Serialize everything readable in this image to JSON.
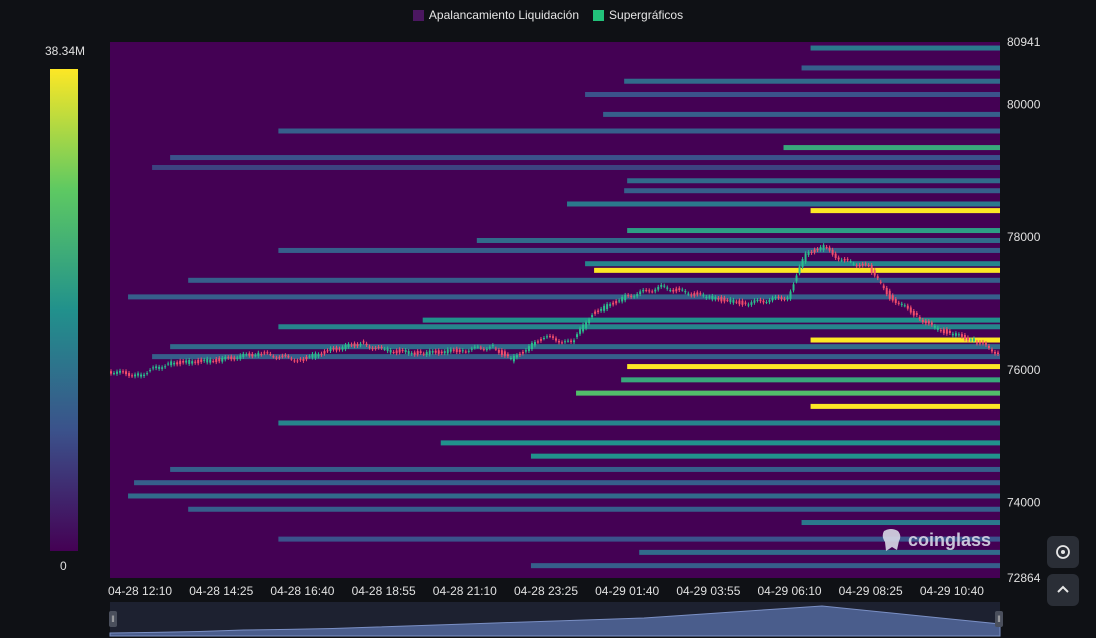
{
  "legend": {
    "items": [
      {
        "label": "Apalancamiento Liquidación",
        "color": "#4b1760"
      },
      {
        "label": "Supergráficos",
        "color": "#22c27a"
      }
    ]
  },
  "colorbar": {
    "max_label": "38.34M",
    "min_label": "0"
  },
  "watermark": {
    "text": "coinglass"
  },
  "controls": {
    "settings_icon": "settings-gear-icon",
    "up_icon": "chevron-up-icon"
  },
  "chart_data": {
    "type": "heatmap",
    "subtype": "liquidation-heatmap-with-candlesticks",
    "y_axis": {
      "position": "right",
      "range": [
        72864,
        80941
      ],
      "tick_labels": [
        "80941",
        "80000",
        "78000",
        "76000",
        "74000",
        "72864"
      ]
    },
    "x_axis": {
      "range": [
        "04-28 11:20",
        "04-29 12:00"
      ],
      "tick_labels": [
        "04-28 12:10",
        "04-28 14:25",
        "04-28 16:40",
        "04-28 18:55",
        "04-28 21:10",
        "04-28 23:25",
        "04-29 01:40",
        "04-29 03:55",
        "04-29 06:10",
        "04-29 08:25",
        "04-29 10:40"
      ]
    },
    "colorscale": {
      "min": 0,
      "max": 38340000,
      "colors": [
        "#440154",
        "#3b528b",
        "#21918c",
        "#5ec962",
        "#fde725"
      ]
    },
    "heat_bands": [
      {
        "price": 80850,
        "start": "04-29 06:45",
        "intensity": 0.4
      },
      {
        "price": 80550,
        "start": "04-29 06:30",
        "intensity": 0.3
      },
      {
        "price": 80350,
        "start": "04-29 01:35",
        "intensity": 0.35
      },
      {
        "price": 80150,
        "start": "04-29 00:30",
        "intensity": 0.25
      },
      {
        "price": 79850,
        "start": "04-29 01:00",
        "intensity": 0.3
      },
      {
        "price": 79600,
        "start": "04-28 16:00",
        "intensity": 0.3
      },
      {
        "price": 79350,
        "start": "04-29 06:00",
        "intensity": 0.6
      },
      {
        "price": 79200,
        "start": "04-28 13:00",
        "intensity": 0.25
      },
      {
        "price": 79050,
        "start": "04-28 12:30",
        "intensity": 0.2
      },
      {
        "price": 78850,
        "start": "04-29 01:40",
        "intensity": 0.35
      },
      {
        "price": 78700,
        "start": "04-29 01:35",
        "intensity": 0.3
      },
      {
        "price": 78500,
        "start": "04-29 00:00",
        "intensity": 0.4
      },
      {
        "price": 78400,
        "start": "04-29 06:45",
        "intensity": 1.0
      },
      {
        "price": 78100,
        "start": "04-29 01:40",
        "intensity": 0.55
      },
      {
        "price": 77950,
        "start": "04-28 21:30",
        "intensity": 0.35
      },
      {
        "price": 77800,
        "start": "04-28 16:00",
        "intensity": 0.3
      },
      {
        "price": 77600,
        "start": "04-29 00:30",
        "intensity": 0.45
      },
      {
        "price": 77500,
        "start": "04-29 00:45",
        "intensity": 1.0
      },
      {
        "price": 77350,
        "start": "04-28 13:30",
        "intensity": 0.3
      },
      {
        "price": 77100,
        "start": "04-28 11:50",
        "intensity": 0.3
      },
      {
        "price": 76750,
        "start": "04-28 20:00",
        "intensity": 0.5
      },
      {
        "price": 76650,
        "start": "04-28 16:00",
        "intensity": 0.45
      },
      {
        "price": 76450,
        "start": "04-29 06:45",
        "intensity": 1.0
      },
      {
        "price": 76350,
        "start": "04-28 13:00",
        "intensity": 0.35
      },
      {
        "price": 76200,
        "start": "04-28 12:30",
        "intensity": 0.3
      },
      {
        "price": 76050,
        "start": "04-29 01:40",
        "intensity": 1.0
      },
      {
        "price": 75850,
        "start": "04-29 01:30",
        "intensity": 0.6
      },
      {
        "price": 75650,
        "start": "04-29 00:15",
        "intensity": 0.7
      },
      {
        "price": 75450,
        "start": "04-29 06:45",
        "intensity": 1.0
      },
      {
        "price": 75200,
        "start": "04-28 16:00",
        "intensity": 0.45
      },
      {
        "price": 74900,
        "start": "04-28 20:30",
        "intensity": 0.5
      },
      {
        "price": 74700,
        "start": "04-28 23:00",
        "intensity": 0.5
      },
      {
        "price": 74500,
        "start": "04-28 13:00",
        "intensity": 0.3
      },
      {
        "price": 74300,
        "start": "04-28 12:00",
        "intensity": 0.3
      },
      {
        "price": 74100,
        "start": "04-28 11:50",
        "intensity": 0.35
      },
      {
        "price": 73900,
        "start": "04-28 13:30",
        "intensity": 0.3
      },
      {
        "price": 73700,
        "start": "04-29 06:30",
        "intensity": 0.4
      },
      {
        "price": 73450,
        "start": "04-28 16:00",
        "intensity": 0.25
      },
      {
        "price": 73250,
        "start": "04-29 02:00",
        "intensity": 0.35
      },
      {
        "price": 73050,
        "start": "04-28 23:00",
        "intensity": 0.3
      }
    ],
    "price_series": [
      {
        "t": "04-28 11:20",
        "price": 75980
      },
      {
        "t": "04-28 12:10",
        "price": 75920
      },
      {
        "t": "04-28 13:00",
        "price": 76100
      },
      {
        "t": "04-28 14:25",
        "price": 76150
      },
      {
        "t": "04-28 15:30",
        "price": 76250
      },
      {
        "t": "04-28 16:40",
        "price": 76150
      },
      {
        "t": "04-28 17:30",
        "price": 76300
      },
      {
        "t": "04-28 18:20",
        "price": 76400
      },
      {
        "t": "04-28 18:55",
        "price": 76300
      },
      {
        "t": "04-28 20:00",
        "price": 76250
      },
      {
        "t": "04-28 21:10",
        "price": 76300
      },
      {
        "t": "04-28 22:00",
        "price": 76350
      },
      {
        "t": "04-28 22:30",
        "price": 76150
      },
      {
        "t": "04-28 23:25",
        "price": 76500
      },
      {
        "t": "04-29 00:10",
        "price": 76400
      },
      {
        "t": "04-29 00:45",
        "price": 76850
      },
      {
        "t": "04-29 01:40",
        "price": 77100
      },
      {
        "t": "04-29 02:40",
        "price": 77250
      },
      {
        "t": "04-29 03:55",
        "price": 77100
      },
      {
        "t": "04-29 05:00",
        "price": 77000
      },
      {
        "t": "04-29 06:10",
        "price": 77100
      },
      {
        "t": "04-29 06:40",
        "price": 77750
      },
      {
        "t": "04-29 07:10",
        "price": 77850
      },
      {
        "t": "04-29 07:40",
        "price": 77650
      },
      {
        "t": "04-29 08:25",
        "price": 77550
      },
      {
        "t": "04-29 09:00",
        "price": 77100
      },
      {
        "t": "04-29 09:40",
        "price": 76850
      },
      {
        "t": "04-29 10:10",
        "price": 76650
      },
      {
        "t": "04-29 10:40",
        "price": 76550
      },
      {
        "t": "04-29 11:20",
        "price": 76450
      },
      {
        "t": "04-29 12:00",
        "price": 76250
      }
    ],
    "volume_navigator": [
      0.1,
      0.12,
      0.15,
      0.2,
      0.22,
      0.25,
      0.3,
      0.35,
      0.4,
      0.45,
      0.5,
      0.55,
      0.6,
      0.7,
      0.8,
      0.9,
      1.0,
      0.85,
      0.7,
      0.55,
      0.4
    ]
  }
}
